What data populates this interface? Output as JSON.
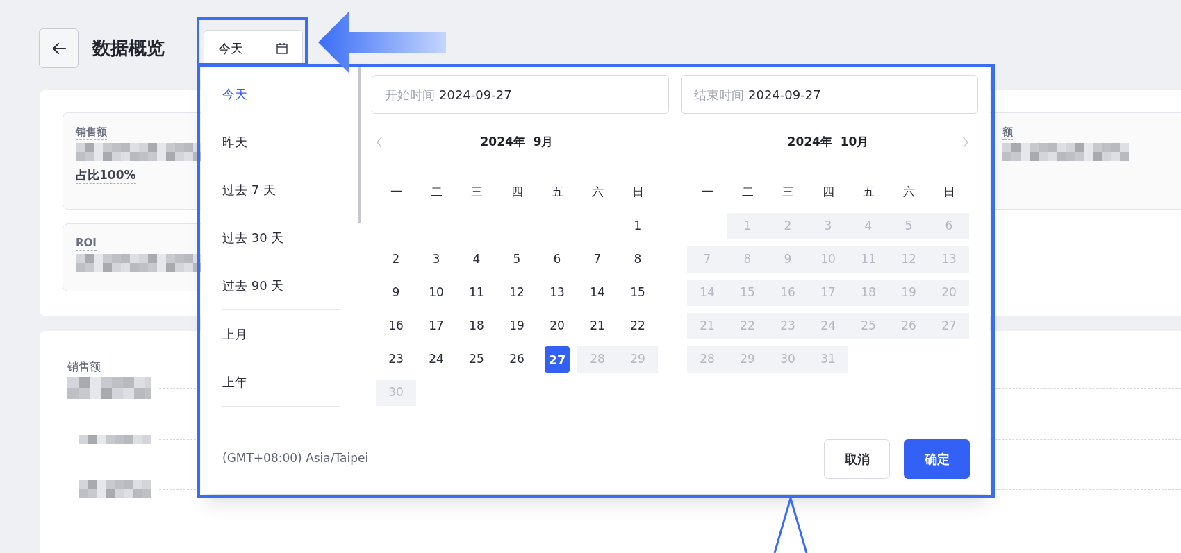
{
  "header": {
    "title": "数据概览",
    "date_button": {
      "label": "今天"
    }
  },
  "metrics_left": [
    {
      "label": "销售额",
      "share": "占比100%"
    },
    {
      "label": "ROI"
    }
  ],
  "metrics_right": [
    {
      "label": "额"
    }
  ],
  "chart": {
    "label": "销售额"
  },
  "picker": {
    "presets": [
      [
        {
          "label": "今天",
          "selected": true
        },
        {
          "label": "昨天",
          "selected": false
        },
        {
          "label": "过去 7 天",
          "selected": false
        },
        {
          "label": "过去 30 天",
          "selected": false
        },
        {
          "label": "过去 90 天",
          "selected": false
        }
      ],
      [
        {
          "label": "上月",
          "selected": false
        },
        {
          "label": "上年",
          "selected": false
        }
      ]
    ],
    "start": {
      "placeholder": "开始时间",
      "value": "2024-09-27"
    },
    "end": {
      "placeholder": "结束时间",
      "value": "2024-09-27"
    },
    "months": [
      {
        "year": "2024年",
        "month": "9月",
        "weekdays": [
          "一",
          "二",
          "三",
          "四",
          "五",
          "六",
          "日"
        ],
        "weeks": [
          [
            {
              "kind": "blank"
            },
            {
              "kind": "blank"
            },
            {
              "kind": "blank"
            },
            {
              "kind": "blank"
            },
            {
              "kind": "blank"
            },
            {
              "kind": "blank"
            },
            {
              "kind": "day",
              "day": "1",
              "selected": false,
              "disabled": false
            }
          ],
          [
            {
              "kind": "day",
              "day": "2",
              "selected": false,
              "disabled": false
            },
            {
              "kind": "day",
              "day": "3",
              "selected": false,
              "disabled": false
            },
            {
              "kind": "day",
              "day": "4",
              "selected": false,
              "disabled": false
            },
            {
              "kind": "day",
              "day": "5",
              "selected": false,
              "disabled": false
            },
            {
              "kind": "day",
              "day": "6",
              "selected": false,
              "disabled": false
            },
            {
              "kind": "day",
              "day": "7",
              "selected": false,
              "disabled": false
            },
            {
              "kind": "day",
              "day": "8",
              "selected": false,
              "disabled": false
            }
          ],
          [
            {
              "kind": "day",
              "day": "9",
              "selected": false,
              "disabled": false
            },
            {
              "kind": "day",
              "day": "10",
              "selected": false,
              "disabled": false
            },
            {
              "kind": "day",
              "day": "11",
              "selected": false,
              "disabled": false
            },
            {
              "kind": "day",
              "day": "12",
              "selected": false,
              "disabled": false
            },
            {
              "kind": "day",
              "day": "13",
              "selected": false,
              "disabled": false
            },
            {
              "kind": "day",
              "day": "14",
              "selected": false,
              "disabled": false
            },
            {
              "kind": "day",
              "day": "15",
              "selected": false,
              "disabled": false
            }
          ],
          [
            {
              "kind": "day",
              "day": "16",
              "selected": false,
              "disabled": false
            },
            {
              "kind": "day",
              "day": "17",
              "selected": false,
              "disabled": false
            },
            {
              "kind": "day",
              "day": "18",
              "selected": false,
              "disabled": false
            },
            {
              "kind": "day",
              "day": "19",
              "selected": false,
              "disabled": false
            },
            {
              "kind": "day",
              "day": "20",
              "selected": false,
              "disabled": false
            },
            {
              "kind": "day",
              "day": "21",
              "selected": false,
              "disabled": false
            },
            {
              "kind": "day",
              "day": "22",
              "selected": false,
              "disabled": false
            }
          ],
          [
            {
              "kind": "day",
              "day": "23",
              "selected": false,
              "disabled": false
            },
            {
              "kind": "day",
              "day": "24",
              "selected": false,
              "disabled": false
            },
            {
              "kind": "day",
              "day": "25",
              "selected": false,
              "disabled": false
            },
            {
              "kind": "day",
              "day": "26",
              "selected": false,
              "disabled": false
            },
            {
              "kind": "day",
              "day": "27",
              "selected": true,
              "disabled": false
            },
            {
              "kind": "day",
              "day": "28",
              "selected": false,
              "disabled": true
            },
            {
              "kind": "day",
              "day": "29",
              "selected": false,
              "disabled": true
            }
          ],
          [
            {
              "kind": "day",
              "day": "30",
              "selected": false,
              "disabled": true
            }
          ]
        ]
      },
      {
        "year": "2024年",
        "month": "10月",
        "weekdays": [
          "一",
          "二",
          "三",
          "四",
          "五",
          "六",
          "日"
        ],
        "weeks": [
          [
            {
              "kind": "blank"
            },
            {
              "kind": "day",
              "day": "1",
              "selected": false,
              "disabled": true
            },
            {
              "kind": "day",
              "day": "2",
              "selected": false,
              "disabled": true
            },
            {
              "kind": "day",
              "day": "3",
              "selected": false,
              "disabled": true
            },
            {
              "kind": "day",
              "day": "4",
              "selected": false,
              "disabled": true
            },
            {
              "kind": "day",
              "day": "5",
              "selected": false,
              "disabled": true
            },
            {
              "kind": "day",
              "day": "6",
              "selected": false,
              "disabled": true
            }
          ],
          [
            {
              "kind": "day",
              "day": "7",
              "selected": false,
              "disabled": true
            },
            {
              "kind": "day",
              "day": "8",
              "selected": false,
              "disabled": true
            },
            {
              "kind": "day",
              "day": "9",
              "selected": false,
              "disabled": true
            },
            {
              "kind": "day",
              "day": "10",
              "selected": false,
              "disabled": true
            },
            {
              "kind": "day",
              "day": "11",
              "selected": false,
              "disabled": true
            },
            {
              "kind": "day",
              "day": "12",
              "selected": false,
              "disabled": true
            },
            {
              "kind": "day",
              "day": "13",
              "selected": false,
              "disabled": true
            }
          ],
          [
            {
              "kind": "day",
              "day": "14",
              "selected": false,
              "disabled": true
            },
            {
              "kind": "day",
              "day": "15",
              "selected": false,
              "disabled": true
            },
            {
              "kind": "day",
              "day": "16",
              "selected": false,
              "disabled": true
            },
            {
              "kind": "day",
              "day": "17",
              "selected": false,
              "disabled": true
            },
            {
              "kind": "day",
              "day": "18",
              "selected": false,
              "disabled": true
            },
            {
              "kind": "day",
              "day": "19",
              "selected": false,
              "disabled": true
            },
            {
              "kind": "day",
              "day": "20",
              "selected": false,
              "disabled": true
            }
          ],
          [
            {
              "kind": "day",
              "day": "21",
              "selected": false,
              "disabled": true
            },
            {
              "kind": "day",
              "day": "22",
              "selected": false,
              "disabled": true
            },
            {
              "kind": "day",
              "day": "23",
              "selected": false,
              "disabled": true
            },
            {
              "kind": "day",
              "day": "24",
              "selected": false,
              "disabled": true
            },
            {
              "kind": "day",
              "day": "25",
              "selected": false,
              "disabled": true
            },
            {
              "kind": "day",
              "day": "26",
              "selected": false,
              "disabled": true
            },
            {
              "kind": "day",
              "day": "27",
              "selected": false,
              "disabled": true
            }
          ],
          [
            {
              "kind": "day",
              "day": "28",
              "selected": false,
              "disabled": true
            },
            {
              "kind": "day",
              "day": "29",
              "selected": false,
              "disabled": true
            },
            {
              "kind": "day",
              "day": "30",
              "selected": false,
              "disabled": true
            },
            {
              "kind": "day",
              "day": "31",
              "selected": false,
              "disabled": true
            }
          ]
        ]
      }
    ],
    "timezone": "(GMT+08:00) Asia/Taipei",
    "buttons": [
      {
        "label": "取消",
        "kind": "secondary"
      },
      {
        "label": "确定",
        "kind": "primary"
      }
    ]
  }
}
